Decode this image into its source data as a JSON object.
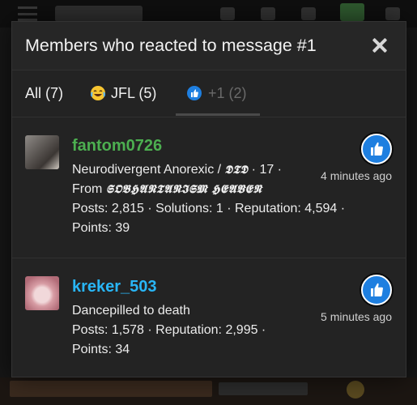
{
  "modal": {
    "title": "Members who reacted to message #1"
  },
  "tabs": [
    {
      "label": "All (7)",
      "icon": null
    },
    {
      "label": "JFL (5)",
      "icon": "laughing-crying-emoji-icon"
    },
    {
      "label": "+1 (2)",
      "icon": "thumbs-up-icon"
    }
  ],
  "members": [
    {
      "username": "fantom0726",
      "name_color": "#4caf50",
      "line1_text": "Neurodivergent Anorexic / ",
      "line1_gothic": "𝕯𝕿𝕯",
      "line1_suffix": " · 17 ·",
      "line2_text": "From ",
      "line2_gothic": "𝕾𝕺𝕭𝕳𝕬𝕹𝕿𝕬𝕹𝕴𝕾𝕸 𝕳𝕰𝕬𝖁𝕰𝕹",
      "stats_line": "Posts: 2,815 · Solutions: 1 · Reputation: 4,594 ·",
      "points_line": "Points: 39",
      "time": "4 minutes ago",
      "reaction_icon": "thumbs-up-icon"
    },
    {
      "username": "kreker_503",
      "name_color": "#29b6f6",
      "line1_text": "Dancepilled to death",
      "stats_line": "Posts: 1,578 · Reputation: 2,995 ·",
      "points_line": "Points: 34",
      "time": "5 minutes ago",
      "reaction_icon": "thumbs-up-icon"
    }
  ],
  "colors": {
    "accent_blue": "#1e7fe0",
    "background": "#232323"
  }
}
